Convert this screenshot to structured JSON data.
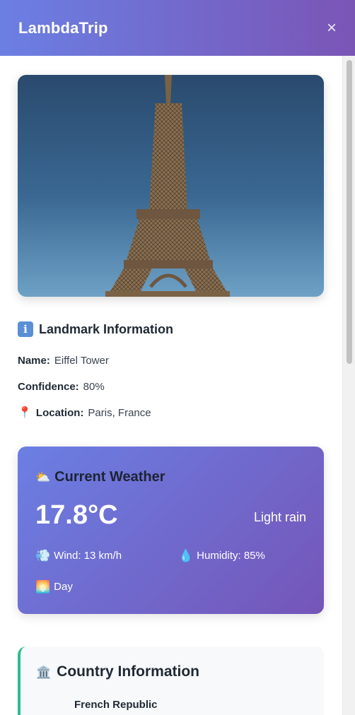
{
  "app": {
    "title": "LambdaTrip",
    "close_label": "×"
  },
  "landmark": {
    "heading": "Landmark Information",
    "name_label": "Name:",
    "name": "Eiffel Tower",
    "confidence_label": "Confidence:",
    "confidence": "80%",
    "location_label": "Location:",
    "location": "Paris, France",
    "icons": {
      "heading": "info-icon",
      "location": "pin-icon"
    }
  },
  "weather": {
    "heading": "Current Weather",
    "temperature": "17.8°C",
    "condition": "Light rain",
    "wind": "Wind: 13 km/h",
    "humidity": "Humidity: 85%",
    "period": "Day",
    "icons": {
      "heading": "sun-cloud-icon",
      "wind": "wind-icon",
      "humidity": "droplet-icon",
      "period": "sunrise-icon"
    }
  },
  "country": {
    "heading": "Country Information",
    "official_name": "French Republic",
    "icons": {
      "heading": "bank-icon"
    },
    "accent_color": "#2bbf8a"
  },
  "theme": {
    "header_gradient_start": "#6b7fe3",
    "header_gradient_end": "#7a55b6"
  }
}
